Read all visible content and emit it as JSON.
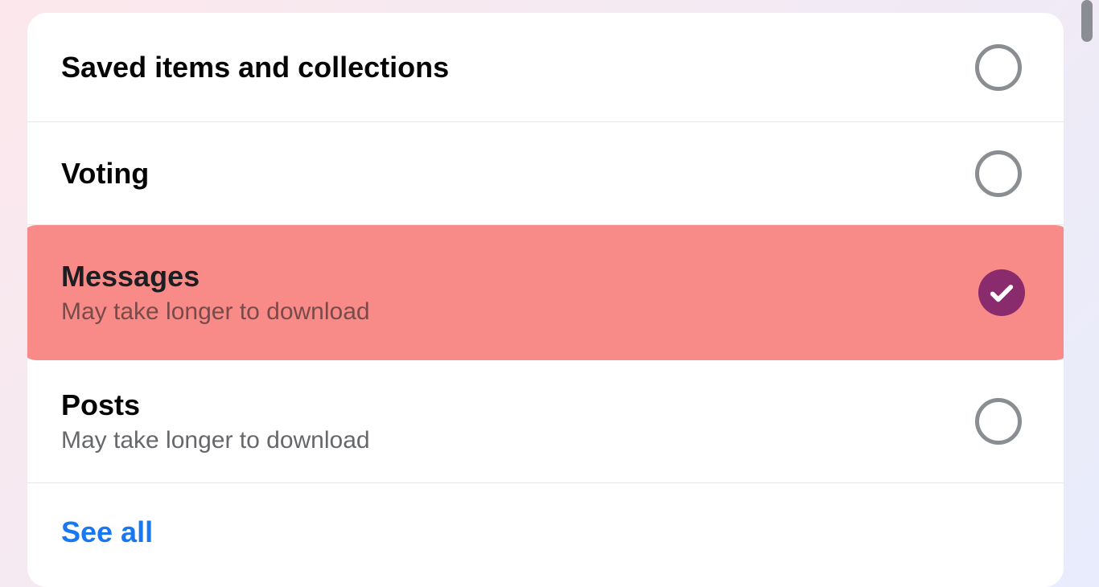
{
  "items": [
    {
      "title": "Saved items and collections",
      "subtitle": null,
      "checked": false,
      "highlighted": false
    },
    {
      "title": "Voting",
      "subtitle": null,
      "checked": false,
      "highlighted": false
    },
    {
      "title": "Messages",
      "subtitle": "May take longer to download",
      "checked": true,
      "highlighted": true
    },
    {
      "title": "Posts",
      "subtitle": "May take longer to download",
      "checked": false,
      "highlighted": false
    }
  ],
  "see_all_label": "See all"
}
